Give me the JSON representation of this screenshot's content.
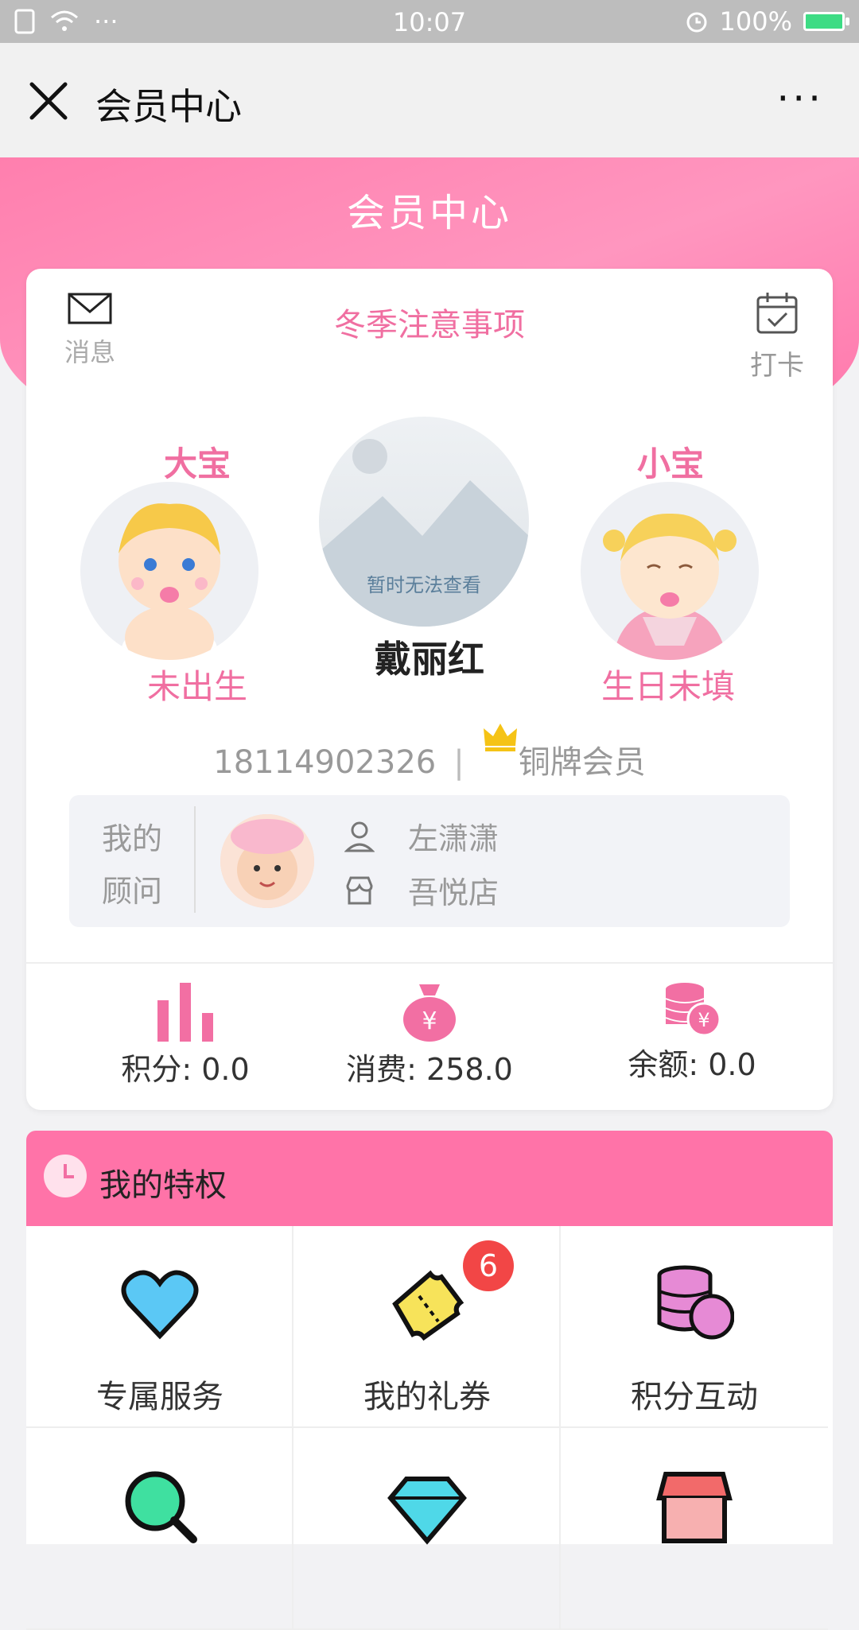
{
  "status_bar": {
    "time": "10:07",
    "battery": "100%"
  },
  "title_bar": {
    "title": "会员中心",
    "more": "···"
  },
  "header": {
    "title": "会员中心"
  },
  "card": {
    "message_label": "消息",
    "notice": "冬季注意事项",
    "checkin_label": "打卡",
    "kids": [
      {
        "label": "大宝",
        "status": "未出生"
      },
      {
        "label": "小宝",
        "status": "生日未填"
      }
    ],
    "avatar_caption": "暂时无法查看",
    "member_name": "戴丽红",
    "phone": "18114902326",
    "separator": "|",
    "level": "铜牌会员",
    "advisor": {
      "label_line1": "我的",
      "label_line2": "顾问",
      "name": "左潇潇",
      "store": "吾悦店"
    },
    "stats": [
      {
        "label": "积分: 0.0",
        "icon": "bar-chart-icon"
      },
      {
        "label": "消费: 258.0",
        "icon": "money-bag-icon"
      },
      {
        "label": "余额: 0.0",
        "icon": "coins-icon"
      }
    ]
  },
  "privileges": {
    "title": "我的特权",
    "items": [
      {
        "label": "专属服务",
        "icon": "heart-icon"
      },
      {
        "label": "我的礼券",
        "icon": "ticket-icon",
        "badge": "6"
      },
      {
        "label": "积分互动",
        "icon": "coin-stack-icon"
      },
      {
        "label": "",
        "icon": "search-icon"
      },
      {
        "label": "",
        "icon": "diamond-icon"
      },
      {
        "label": "",
        "icon": "shop-icon"
      }
    ]
  },
  "colors": {
    "accent": "#ff73a8",
    "pink_text": "#f06fa1",
    "badge": "#f24646"
  }
}
